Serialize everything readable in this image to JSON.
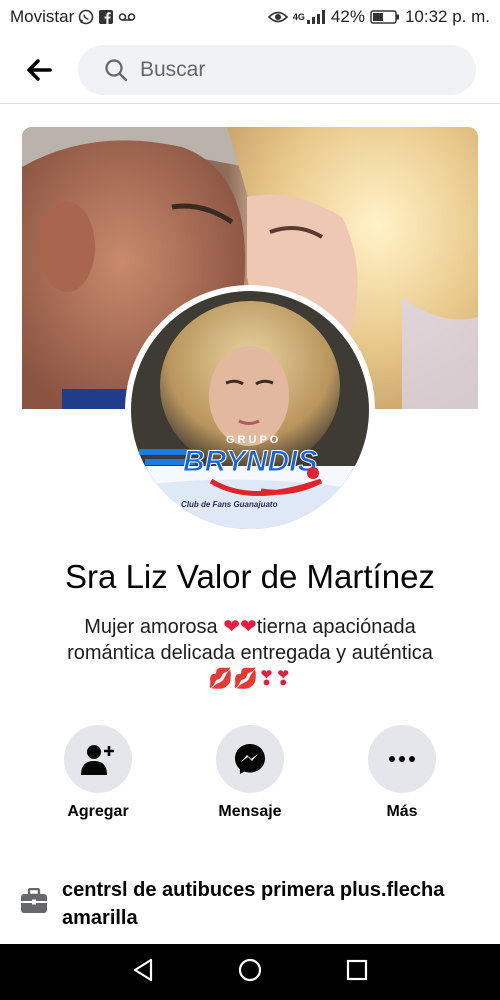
{
  "status_bar": {
    "carrier": "Movistar",
    "network": "4G",
    "battery": "42%",
    "time": "10:32 p. m."
  },
  "header": {
    "search_placeholder": "Buscar"
  },
  "profile": {
    "name": "Sra Liz Valor de Martínez",
    "bio_line1_a": "Mujer amorosa",
    "bio_line1_b": "tierna apaciónada",
    "bio_line2": "romántica delicada entregada y auténtica",
    "avatar_badge_top": "GRUPO",
    "avatar_badge_main": "BRYNDIS",
    "avatar_badge_sub": "Club de Fans Guanajuato"
  },
  "actions": [
    {
      "label": "Agregar",
      "icon": "add-friend-icon"
    },
    {
      "label": "Mensaje",
      "icon": "messenger-icon"
    },
    {
      "label": "Más",
      "icon": "more-icon"
    }
  ],
  "work": {
    "text": "centrsl de autibuces primera plus.flecha amarilla",
    "icon": "briefcase-icon"
  },
  "colors": {
    "accent": "#1877f2",
    "chip_bg": "#e4e6eb",
    "search_bg": "#f0f2f5",
    "heart": "#e41e3f"
  }
}
